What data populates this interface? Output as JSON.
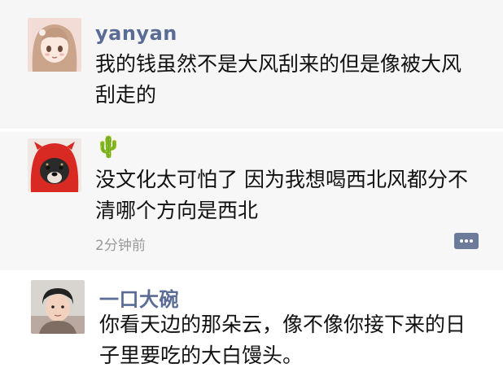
{
  "comments": [
    {
      "user": "yanyan",
      "avatar_icon": "anime-girl-avatar-icon",
      "line1": "我的钱虽然不是大风刮来的但是像被大风",
      "line2": "刮走的"
    },
    {
      "user_emoji": "🌵",
      "avatar_icon": "dog-in-red-costume-avatar-icon",
      "line1": "没文化太可怕了 因为我想喝西北风都分不",
      "line2": "清哪个方向是西北",
      "time": "2分钟前",
      "comment_icon": "comment-bubble-icon"
    },
    {
      "user": "一口大碗",
      "avatar_icon": "child-photo-avatar-icon",
      "line1": "你看天边的那朵云，像不像你接下来的日",
      "line2": "子里要吃的大白馒头。"
    }
  ],
  "colors": {
    "username": "#5a6c95",
    "timestamp": "#9a9a9a",
    "comment_button": "#6d7b9a"
  }
}
